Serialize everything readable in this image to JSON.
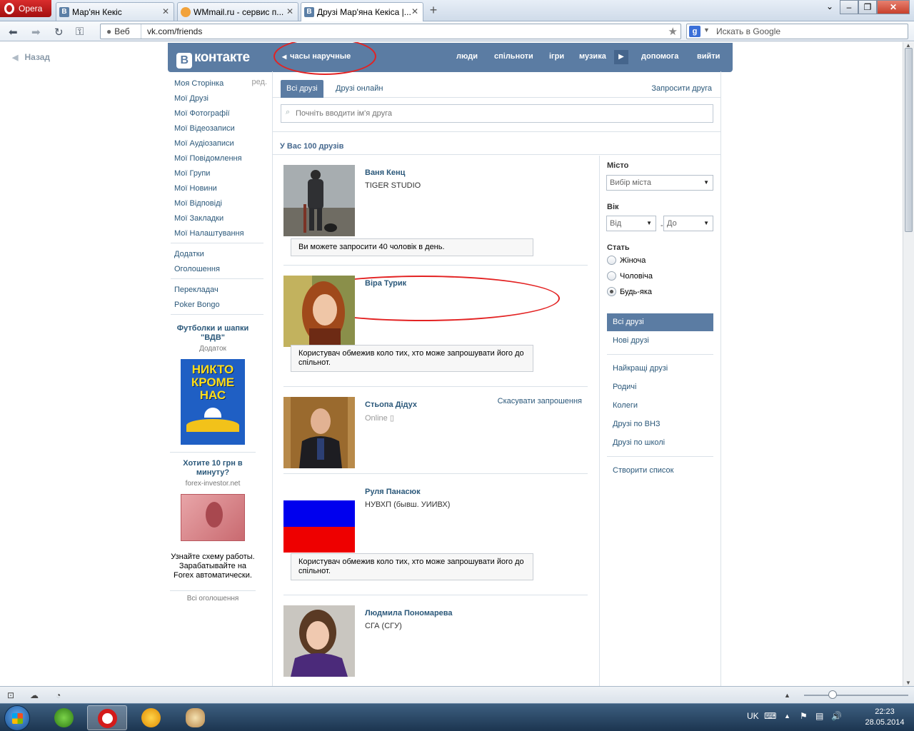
{
  "browser": {
    "opera_label": "Opera",
    "tabs": [
      {
        "title": "Мар'ян Кекіс",
        "favicon": "В"
      },
      {
        "title": "WMmail.ru - сервис п...",
        "favicon": ""
      },
      {
        "title": "Друзі Мар'яна Кекіса |...",
        "favicon": "В"
      }
    ],
    "web_label": "Веб",
    "url": "vk.com/friends",
    "search_placeholder": "Искать в Google",
    "search_engine_letter": "g"
  },
  "vk": {
    "back_label": "Назад",
    "logo_text": "контакте",
    "logo_letter": "В",
    "status_text": "часы наручные",
    "topnav": [
      "люди",
      "спільноти",
      "ігри",
      "музика",
      "допомога",
      "вийти"
    ],
    "left_menu": {
      "primary": [
        "Моя Сторінка",
        "Мої Друзі",
        "Мої Фотографії",
        "Мої Відеозаписи",
        "Мої Аудіозаписи",
        "Мої Повідомлення",
        "Мої Групи",
        "Мої Новини",
        "Мої Відповіді",
        "Мої Закладки",
        "Мої Налаштування"
      ],
      "edit_label": "ред.",
      "secondary": [
        "Додатки",
        "Оголошення"
      ],
      "apps": [
        "Перекладач",
        "Poker Bongo"
      ]
    },
    "ads": [
      {
        "title": "Футболки и шапки \"ВДВ\"",
        "subtitle": "Додаток",
        "image_text": "НИКТО КРОМЕ НАС"
      },
      {
        "title": "Хотите 10 грн в минуту?",
        "subtitle": "forex-investor.net",
        "description": "Узнайте схему работы. Зарабатывайте на Forex автоматически."
      }
    ],
    "all_ads_label": "Всі оголошення",
    "tabs": {
      "all": "Всі друзі",
      "online": "Друзі онлайн",
      "invite": "Запросити друга"
    },
    "search_placeholder": "Почніть вводити ім'я друга",
    "friends_count": "У Вас 100 друзів",
    "friends": [
      {
        "name": "Ваня Кенц",
        "subtitle": "TIGER STUDIO",
        "note": "Ви можете запросити 40 чоловік в день.",
        "action": ""
      },
      {
        "name": "Віра Турик",
        "subtitle": "",
        "note": "Користувач обмежив коло тих, хто може запрошувати його до спільнот.",
        "action": ""
      },
      {
        "name": "Стьопа Дідух",
        "subtitle": "Online",
        "note": "",
        "action": "Скасувати запрошення"
      },
      {
        "name": "Руля Панасюк",
        "subtitle": "НУВХП (бывш. УИИВХ)",
        "note": "Користувач обмежив коло тих, хто може запрошувати його до спільнот.",
        "action": ""
      },
      {
        "name": "Людмила Пономарева",
        "subtitle": "СГА (СГУ)",
        "note": "",
        "action": ""
      }
    ],
    "filters": {
      "city_label": "Місто",
      "city_value": "Вибір міста",
      "age_label": "Вік",
      "age_from": "Від",
      "age_dash": "-",
      "age_to": "До",
      "gender_label": "Стать",
      "gender_options": [
        "Жіноча",
        "Чоловіча",
        "Будь-яка"
      ],
      "gender_selected": "Будь-яка",
      "lists": [
        "Всі друзі",
        "Нові друзі"
      ],
      "lists2": [
        "Найкращі друзі",
        "Родичі",
        "Колеги",
        "Друзі по ВНЗ",
        "Друзі по школі"
      ],
      "create_list": "Створити список"
    }
  },
  "taskbar": {
    "language": "UK",
    "time": "22:23",
    "date": "28.05.2014"
  },
  "colors": {
    "vk_blue": "#5b7ca3",
    "link": "#2b587a",
    "annotation_red": "#e32222"
  }
}
